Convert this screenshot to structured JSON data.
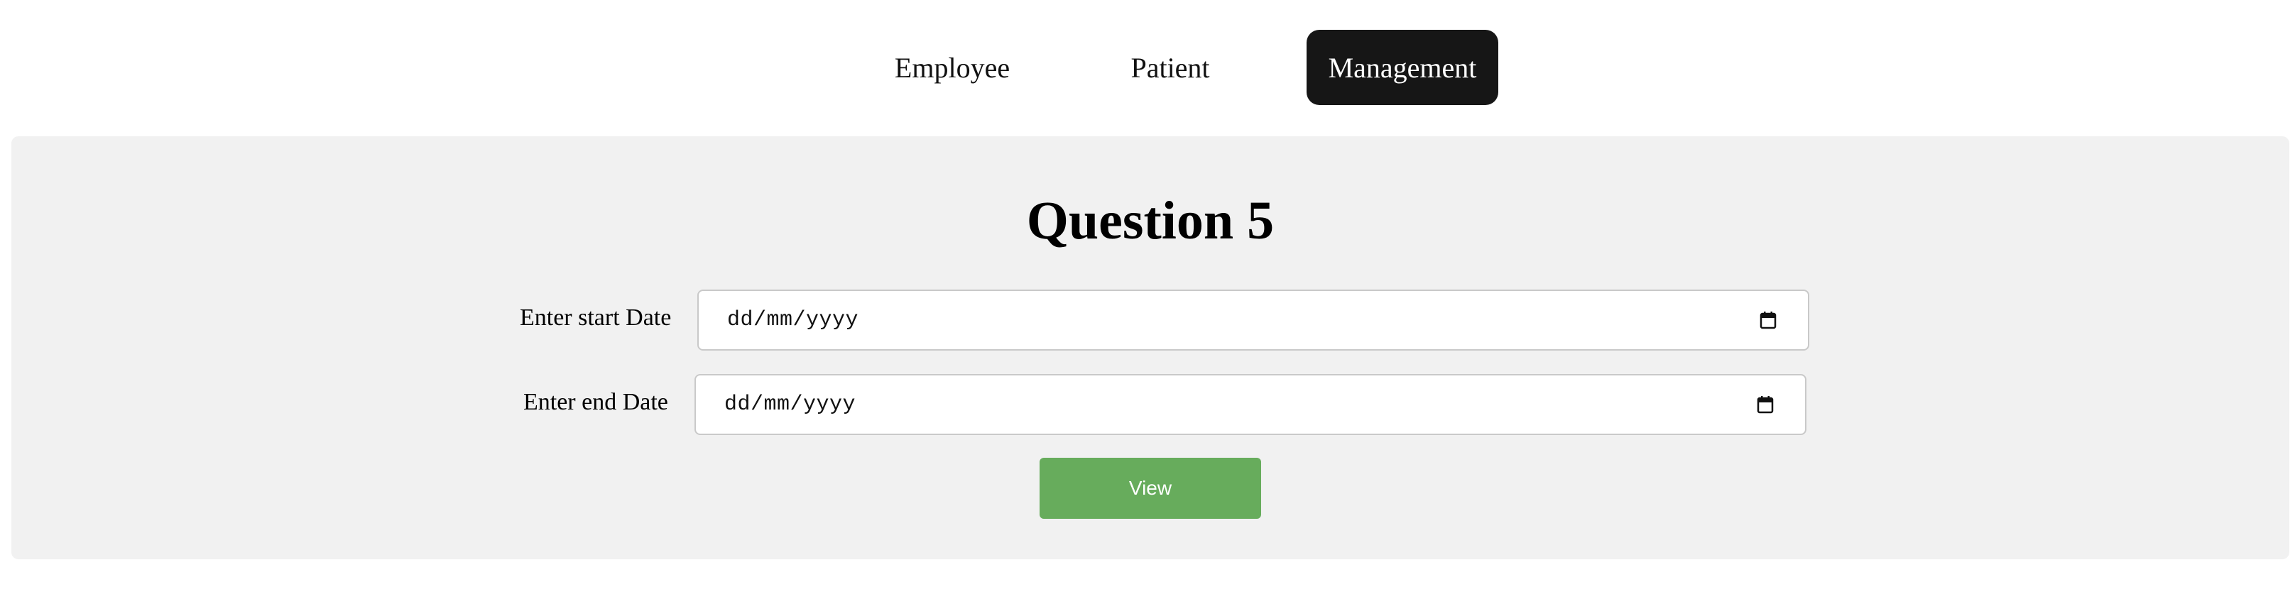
{
  "nav": {
    "items": [
      {
        "label": "Employee",
        "active": false
      },
      {
        "label": "Patient",
        "active": false
      },
      {
        "label": "Management",
        "active": true
      }
    ]
  },
  "main": {
    "title": "Question 5",
    "start_date": {
      "label": "Enter start Date",
      "value": "dd/mm/yyyy",
      "icon": "calendar-icon"
    },
    "end_date": {
      "label": "Enter end Date",
      "value": "dd/mm/yyyy",
      "icon": "calendar-icon"
    },
    "view_button": {
      "label": "View"
    }
  },
  "colors": {
    "nav_active_bg": "#161616",
    "panel_bg": "#f1f1f1",
    "button_bg": "#67ac5c",
    "field_border": "#c9c9c9"
  }
}
